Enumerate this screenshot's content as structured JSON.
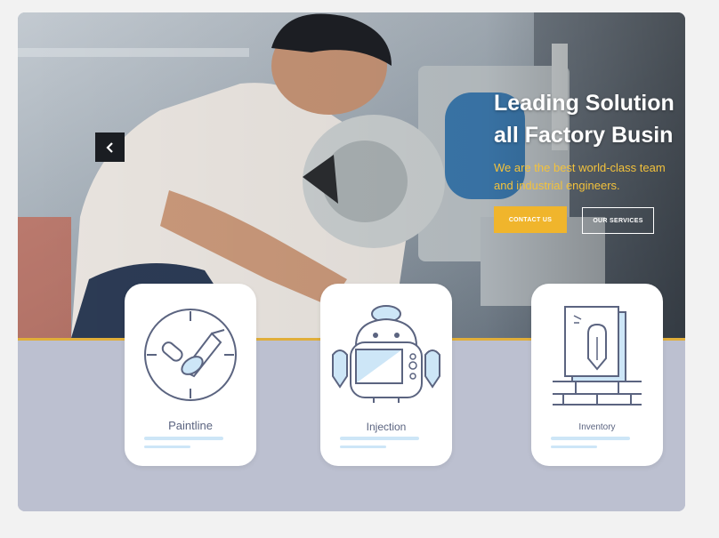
{
  "hero": {
    "title_line1": "Leading Solution",
    "title_line2": "all Factory Busin",
    "subtitle_line1": "We are the best  world-class team",
    "subtitle_line2": "and industrial engineers.",
    "contact_label": "CONTACT US",
    "services_label": "OUR SERVICES",
    "prev_icon": "chevron-left-icon"
  },
  "features": [
    {
      "label": "Paintline",
      "icon": "paint-clock-icon"
    },
    {
      "label": "Injection",
      "icon": "robot-icon"
    },
    {
      "label": "Inventory",
      "icon": "document-pencil-icon"
    }
  ],
  "colors": {
    "accent": "#f0b52c",
    "subtitle": "#f3c23c",
    "lower_bg": "#bcc0d0",
    "page_bg": "#f2f2f2",
    "icon_stroke": "#5b6480",
    "icon_fill": "#cde6f7"
  }
}
